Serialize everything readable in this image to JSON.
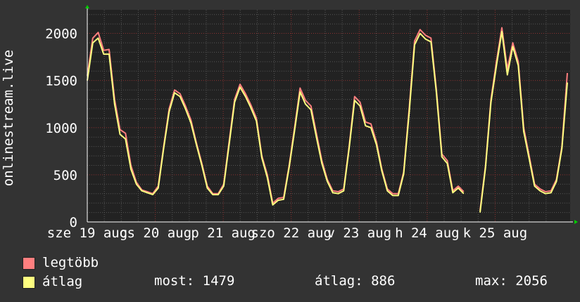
{
  "chart_data": {
    "type": "line",
    "ylabel": "onlinestream.live",
    "ylim": [
      0,
      2250
    ],
    "y_ticks": [
      0,
      500,
      1000,
      1500,
      2000
    ],
    "grid": true,
    "x_tick_labels": [
      "sze 19 aug",
      "cs 20 aug",
      "p 21 aug",
      "szo 22 aug",
      "v 23 aug",
      "h 24 aug",
      "k 25 aug"
    ],
    "series": [
      {
        "name": "legtöbb",
        "color": "#ff7f7f",
        "values": [
          1550,
          1950,
          2010,
          1820,
          1830,
          1300,
          980,
          940,
          600,
          420,
          340,
          320,
          300,
          380,
          800,
          1200,
          1400,
          1360,
          1230,
          1080,
          840,
          620,
          380,
          300,
          300,
          400,
          850,
          1300,
          1460,
          1360,
          1240,
          1100,
          700,
          500,
          200,
          250,
          260,
          600,
          1000,
          1420,
          1290,
          1230,
          940,
          650,
          450,
          330,
          320,
          350,
          800,
          1330,
          1270,
          1060,
          1040,
          850,
          560,
          350,
          300,
          300,
          530,
          1200,
          1920,
          2040,
          1980,
          1950,
          1400,
          720,
          650,
          330,
          380,
          320,
          null,
          null,
          120,
          600,
          1300,
          1700,
          2060,
          1620,
          1900,
          1700,
          1000,
          700,
          400,
          350,
          320,
          330,
          450,
          800,
          1580
        ]
      },
      {
        "name": "átlag",
        "color": "#ffff80",
        "values": [
          1500,
          1900,
          1950,
          1780,
          1780,
          1250,
          930,
          880,
          560,
          400,
          330,
          310,
          290,
          360,
          780,
          1170,
          1370,
          1330,
          1200,
          1050,
          820,
          600,
          360,
          290,
          290,
          380,
          820,
          1270,
          1430,
          1330,
          1210,
          1070,
          680,
          470,
          180,
          230,
          240,
          580,
          970,
          1380,
          1250,
          1190,
          900,
          620,
          430,
          310,
          300,
          330,
          780,
          1290,
          1230,
          1020,
          1000,
          820,
          540,
          330,
          280,
          280,
          510,
          1160,
          1880,
          2000,
          1940,
          1910,
          1370,
          690,
          620,
          310,
          360,
          300,
          null,
          null,
          100,
          580,
          1270,
          1660,
          2020,
          1560,
          1860,
          1660,
          960,
          670,
          380,
          330,
          300,
          310,
          430,
          780,
          1479
        ]
      }
    ]
  },
  "legend": [
    {
      "label": "legtöbb",
      "color": "#ff7f7f"
    },
    {
      "label": "átlag",
      "color": "#ffff80"
    }
  ],
  "stats": {
    "most": "most: 1479",
    "atlag": "átlag: 886",
    "max": "max: 2056"
  }
}
